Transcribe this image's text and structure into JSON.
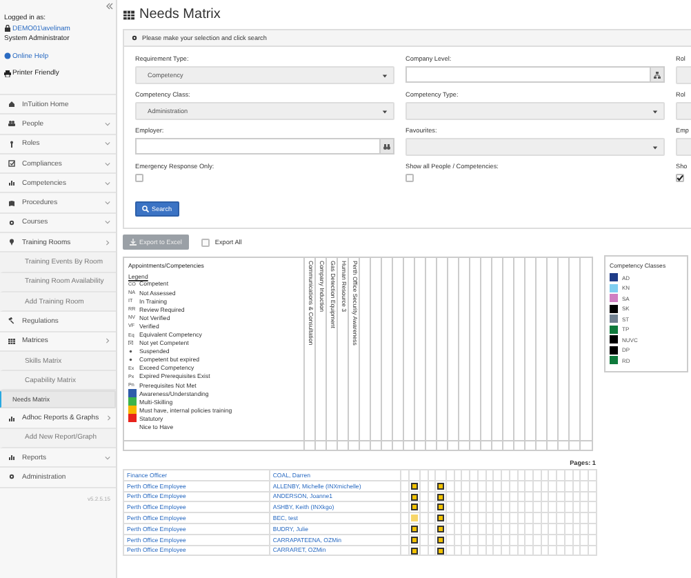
{
  "sidebar": {
    "login_label": "Logged in as:",
    "user": "DEMO01\\avelinam",
    "role": "System Administrator",
    "links": [
      {
        "label": "Online Help",
        "kind": "help"
      },
      {
        "label": "Printer Friendly",
        "kind": "print"
      }
    ],
    "items": [
      {
        "label": "InTuition Home",
        "kind": "link",
        "selected": false
      },
      {
        "label": "People",
        "kind": "group",
        "expanded": false,
        "selected": false
      },
      {
        "label": "Roles",
        "kind": "group",
        "expanded": false,
        "selected": false
      },
      {
        "label": "Compliances",
        "kind": "group",
        "expanded": false,
        "selected": false
      },
      {
        "label": "Competencies",
        "kind": "group",
        "expanded": false,
        "selected": false
      },
      {
        "label": "Procedures",
        "kind": "group",
        "expanded": false,
        "selected": false
      },
      {
        "label": "Courses",
        "kind": "group",
        "expanded": false,
        "selected": false
      },
      {
        "label": "Training Rooms",
        "kind": "group",
        "expanded": true,
        "selected": false,
        "children": [
          {
            "label": "Training Events By Room",
            "selected": false
          },
          {
            "label": "Training Room Availability",
            "selected": false
          },
          {
            "label": "Add Training Room",
            "selected": false
          }
        ]
      },
      {
        "label": "Regulations",
        "kind": "link",
        "selected": false
      },
      {
        "label": "Matrices",
        "kind": "group",
        "expanded": true,
        "selected": false,
        "children": [
          {
            "label": "Skills Matrix",
            "selected": false
          },
          {
            "label": "Capability Matrix",
            "selected": false
          },
          {
            "label": "Needs Matrix",
            "selected": true
          }
        ]
      },
      {
        "label": "Adhoc Reports & Graphs",
        "kind": "group",
        "expanded": true,
        "selected": false,
        "children": [
          {
            "label": "Add New Report/Graph",
            "selected": false
          }
        ]
      },
      {
        "label": "Reports",
        "kind": "group",
        "expanded": false,
        "selected": false
      },
      {
        "label": "Administration",
        "kind": "link",
        "selected": false
      }
    ],
    "version": "v5.2.5.15"
  },
  "title": "Needs Matrix",
  "panel": {
    "heading": "Please make your selection and click search",
    "fields": [
      {
        "label": "Requirement Type:",
        "kind": "select",
        "value": "Competency"
      },
      {
        "label": "Company Level:",
        "kind": "lookup"
      },
      {
        "label": "Rol",
        "kind": "select"
      },
      {
        "label": "Competency Class:",
        "kind": "select",
        "value": "Administration"
      },
      {
        "label": "Competency Type:",
        "kind": "select"
      },
      {
        "label": "Rol",
        "kind": "select"
      },
      {
        "label": "Employer:",
        "kind": "lookup"
      },
      {
        "label": "Favourites:",
        "kind": "select"
      },
      {
        "label": "Emp",
        "kind": "select"
      },
      {
        "label": "Emergency Response Only:",
        "kind": "checkbox",
        "checked": false
      },
      {
        "label": "Show all People / Competencies:",
        "kind": "checkbox",
        "checked": false
      },
      {
        "label": "Sho",
        "kind": "checkbox",
        "checked": true
      }
    ],
    "search_button": "Search"
  },
  "export_button": "Export to Excel",
  "export_all": {
    "label": "Export All",
    "checked": false
  },
  "matrix": {
    "heading": "Appointments/Competencies",
    "legend_title": "Legend",
    "legend": [
      {
        "code": "CO",
        "label": "Competent",
        "kind": "code"
      },
      {
        "code": "NA",
        "label": "Not Assessed",
        "kind": "code"
      },
      {
        "code": "IT",
        "label": "In Training",
        "kind": "code"
      },
      {
        "code": "RR",
        "label": "Review Required",
        "kind": "code"
      },
      {
        "code": "NV",
        "label": "Not Verified",
        "kind": "code"
      },
      {
        "code": "VF",
        "label": "Verified",
        "kind": "code"
      },
      {
        "code": "Eq",
        "label": "Equivalent Competency",
        "kind": "code"
      },
      {
        "label": "Not yet Competent",
        "kind": "cross"
      },
      {
        "label": "Suspended",
        "kind": "dot"
      },
      {
        "label": "Competent but expired",
        "kind": "dot"
      },
      {
        "code": "Ex",
        "label": "Exceed Competency",
        "kind": "code"
      },
      {
        "code": "Px",
        "label": "Expired Prerequisites Exist",
        "kind": "code"
      },
      {
        "code": "Pn",
        "label": "Prerequisites Not Met",
        "kind": "code"
      },
      {
        "label": "Awareness/Understanding",
        "kind": "swatch",
        "color": "#2f5caa"
      },
      {
        "label": "Multi-Skilling",
        "kind": "swatch",
        "color": "#3cb44b"
      },
      {
        "label": "Must have, internal policies training",
        "kind": "swatch",
        "color": "#f7b500"
      },
      {
        "label": "Statutory",
        "kind": "swatch",
        "color": "#e8231c"
      },
      {
        "label": "Nice to Have",
        "kind": "plain"
      }
    ],
    "columns": [
      "Communications & Consultation",
      "Company Induction",
      "Gas Detection Equipment",
      "Human Resource 3",
      "Perth Office Security Awareness"
    ]
  },
  "classes": {
    "title": "Competency Classes",
    "items": [
      {
        "code": "AD",
        "color": "#1f3c88"
      },
      {
        "code": "KN",
        "color": "#7fcff0"
      },
      {
        "code": "SA",
        "color": "#cf7fc2"
      },
      {
        "code": "SK",
        "color": "#000000"
      },
      {
        "code": "ST",
        "color": "#708090"
      },
      {
        "code": "TP",
        "color": "#0f7a3c"
      },
      {
        "code": "NUVC",
        "color": "#000000"
      },
      {
        "code": "DP",
        "color": "#000000"
      },
      {
        "code": "RD",
        "color": "#0f7a3c"
      }
    ]
  },
  "pages": "Pages: 1",
  "rows": [
    {
      "role": "Finance Officer",
      "name": "COAL, Darren",
      "cells": [
        {
          "kind": "none"
        },
        {
          "kind": "none"
        },
        {
          "kind": "none"
        },
        {
          "kind": "none"
        },
        {
          "kind": "none"
        }
      ]
    },
    {
      "role": "Perth Office Employee",
      "name": "ALLENBY, Michelle (INXmichelle)",
      "cells": [
        {
          "kind": "none"
        },
        {
          "kind": "needed"
        },
        {
          "kind": "none"
        },
        {
          "kind": "none"
        },
        {
          "kind": "needed"
        }
      ]
    },
    {
      "role": "Perth Office Employee",
      "name": "ANDERSON, Joanne1",
      "cells": [
        {
          "kind": "none"
        },
        {
          "kind": "needed"
        },
        {
          "kind": "none"
        },
        {
          "kind": "none"
        },
        {
          "kind": "needed"
        }
      ]
    },
    {
      "role": "Perth Office Employee",
      "name": "ASHBY, Keith (INXkgo)",
      "cells": [
        {
          "kind": "none"
        },
        {
          "kind": "needed"
        },
        {
          "kind": "none"
        },
        {
          "kind": "none"
        },
        {
          "kind": "needed"
        }
      ]
    },
    {
      "role": "Perth Office Employee",
      "name": "BEC, test",
      "cells": [
        {
          "kind": "none"
        },
        {
          "kind": "met"
        },
        {
          "kind": "none"
        },
        {
          "kind": "none"
        },
        {
          "kind": "needed"
        }
      ]
    },
    {
      "role": "Perth Office Employee",
      "name": "BUDRY, Julie",
      "cells": [
        {
          "kind": "none"
        },
        {
          "kind": "needed"
        },
        {
          "kind": "none"
        },
        {
          "kind": "none"
        },
        {
          "kind": "needed"
        }
      ]
    },
    {
      "role": "Perth Office Employee",
      "name": "CARRAPATEENA, OZMin",
      "cells": [
        {
          "kind": "none"
        },
        {
          "kind": "needed"
        },
        {
          "kind": "none"
        },
        {
          "kind": "none"
        },
        {
          "kind": "needed"
        }
      ]
    },
    {
      "role": "Perth Office Employee",
      "name": "CARRARET, OZMin",
      "cells": [
        {
          "kind": "none"
        },
        {
          "kind": "needed"
        },
        {
          "kind": "none"
        },
        {
          "kind": "none"
        },
        {
          "kind": "needed"
        }
      ]
    }
  ]
}
